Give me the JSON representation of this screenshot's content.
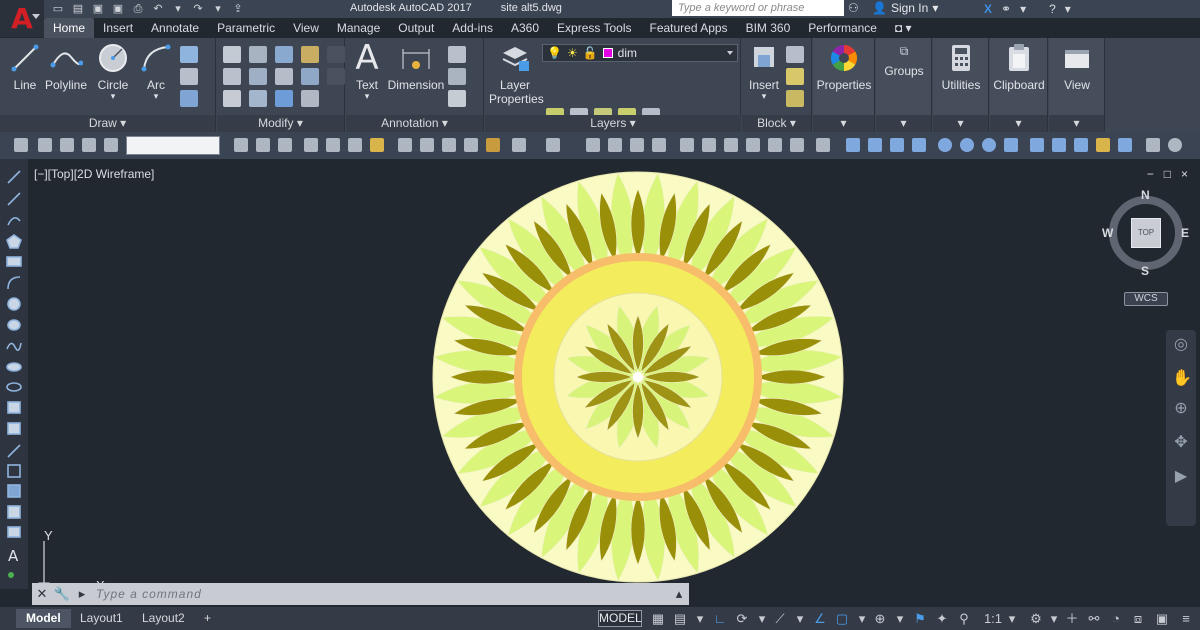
{
  "window": {
    "app_title": "Autodesk AutoCAD 2017",
    "file_name": "site alt5.dwg",
    "search_placeholder": "Type a keyword or phrase",
    "sign_in": "Sign In"
  },
  "ribbon_tabs": [
    "Home",
    "Insert",
    "Annotate",
    "Parametric",
    "View",
    "Manage",
    "Output",
    "Add-ins",
    "A360",
    "Express Tools",
    "Featured Apps",
    "BIM 360",
    "Performance"
  ],
  "ribbon": {
    "draw": {
      "label": "Draw",
      "buttons": [
        "Line",
        "Polyline",
        "Circle",
        "Arc"
      ]
    },
    "modify": {
      "label": "Modify"
    },
    "annotation": {
      "label": "Annotation",
      "buttons": [
        "Text",
        "Dimension"
      ]
    },
    "layers": {
      "label": "Layers",
      "button_line1": "Layer",
      "button_line2": "Properties",
      "current_layer": "dim",
      "layer_color": "#e600e6"
    },
    "block": {
      "label": "Block",
      "button": "Insert"
    },
    "properties": {
      "label": "Properties"
    },
    "groups": {
      "label": "Groups"
    },
    "utilities": {
      "label": "Utilities"
    },
    "clipboard": {
      "label": "Clipboard"
    },
    "view": {
      "label": "View"
    }
  },
  "viewport": {
    "label": "[−][Top][2D Wireframe]",
    "controls": [
      "−",
      "□",
      "×"
    ]
  },
  "viewcube": {
    "north": "N",
    "south": "S",
    "east": "E",
    "west": "W",
    "face": "TOP",
    "wcs": "WCS"
  },
  "ucs": {
    "y_label": "Y",
    "x_label": "X"
  },
  "command": {
    "placeholder": "Type a command"
  },
  "layout_tabs": [
    "Model",
    "Layout1",
    "Layout2"
  ],
  "status": {
    "mode": "MODEL",
    "scale": "1:1"
  },
  "drawing_colors": {
    "outer_disc": "#fafac4",
    "light_petal": "#d9f57a",
    "dark_petal": "#9a8f08",
    "gap": "#1515e0",
    "orange_ring": "#f7bd6a",
    "yellow_ring": "#f3ec5c",
    "inner_disc": "#f9f7b0",
    "inner_petal_light": "#d8f37a",
    "inner_petal_dark": "#9f9316"
  }
}
